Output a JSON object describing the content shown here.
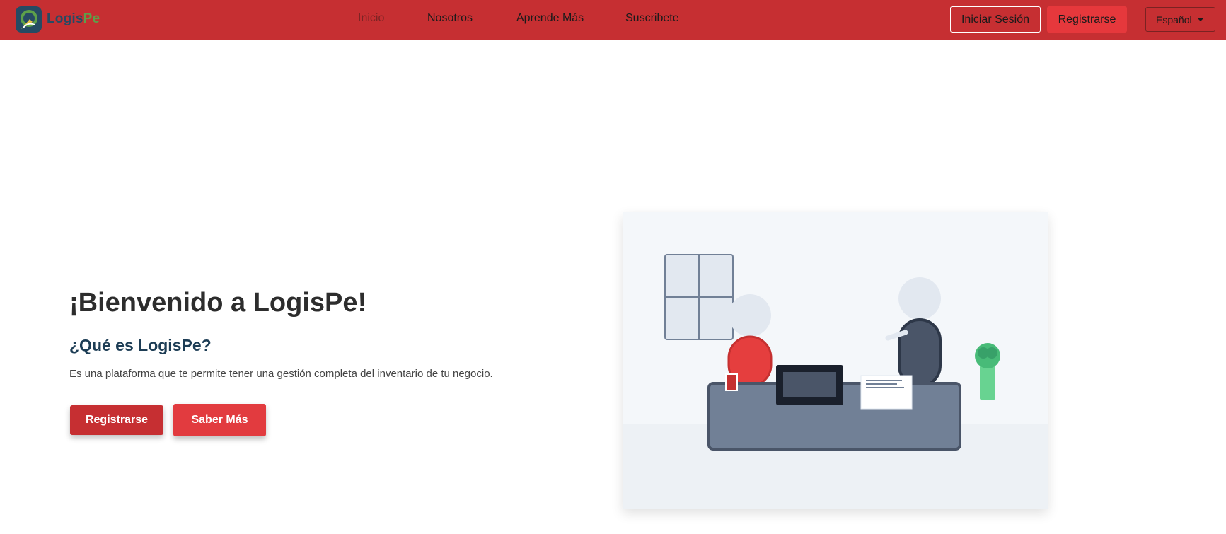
{
  "brand": {
    "name_part1": "Logis",
    "name_part2": "Pe",
    "logo_icon": "logispe-logo-icon"
  },
  "nav": {
    "links": [
      {
        "label": "Inicio",
        "active": true
      },
      {
        "label": "Nosotros",
        "active": false
      },
      {
        "label": "Aprende Más",
        "active": false
      },
      {
        "label": "Suscribete",
        "active": false
      }
    ],
    "login_label": "Iniciar Sesión",
    "register_label": "Registrarse",
    "language": "Español",
    "language_icon": "caret-down-icon"
  },
  "hero": {
    "title": "¡Bienvenido a LogisPe!",
    "subtitle": "¿Qué es LogisPe?",
    "description": "Es una plataforma que te permite tener una gestión completa del inventario de tu negocio.",
    "register_button": "Registrarse",
    "more_button": "Saber Más"
  },
  "colors": {
    "navbar": "#c62f32",
    "accent": "#e23b3f",
    "brand_dark": "#264a63",
    "brand_green": "#5da04a",
    "subtitle": "#1d3d55"
  }
}
